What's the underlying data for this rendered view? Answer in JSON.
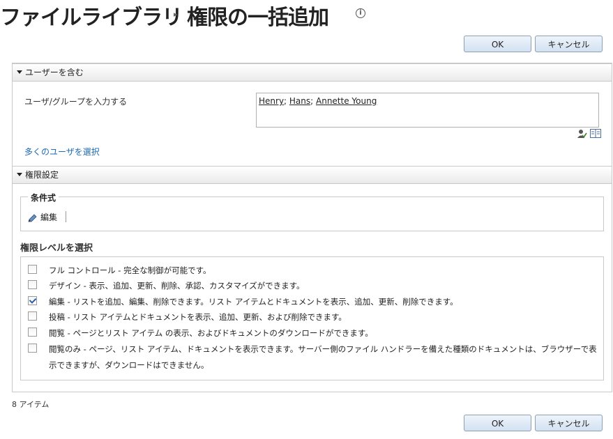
{
  "header": {
    "site_title": "ファイルライブラリ",
    "separator": "▸",
    "page_title": "権限の一括追加",
    "info_icon": "i"
  },
  "buttons": {
    "ok": "OK",
    "cancel": "キャンセル"
  },
  "users_section": {
    "title": "ユーザーを含む",
    "input_label": "ユーザ/グループを入力する",
    "people": [
      "Henry",
      "Hans",
      "Annette Young"
    ],
    "browse_link": "多くのユーザを選択"
  },
  "permissions_section": {
    "title": "権限設定",
    "condition": {
      "legend": "条件式",
      "edit_label": "編集"
    },
    "levels_title": "権限レベルを選択",
    "levels": [
      {
        "text": "フル コントロール - 完全な制御が可能です。",
        "checked": false
      },
      {
        "text": "デザイン - 表示、追加、更新、削除、承認、カスタマイズができます。",
        "checked": false
      },
      {
        "text": "編集 - リストを追加、編集、削除できます。リスト アイテムとドキュメントを表示、追加、更新、削除できます。",
        "checked": true
      },
      {
        "text": "投稿 - リスト アイテムとドキュメントを表示、追加、更新、および削除できます。",
        "checked": false
      },
      {
        "text": "閲覧 - ページとリスト アイテム の表示、およびドキュメントのダウンロードができます。",
        "checked": false
      },
      {
        "text": "閲覧のみ - ページ、リスト アイテム、ドキュメントを表示できます。サーバー側のファイル ハンドラーを備えた種類のドキュメントは、ブラウザーで表示できますが、ダウンロードはできません。",
        "checked": false
      }
    ]
  },
  "footer": {
    "item_count": "8 アイテム"
  },
  "colors": {
    "link": "#1e6ab4",
    "button_border": "#8a9fb8",
    "check": "#2d5fa8"
  }
}
